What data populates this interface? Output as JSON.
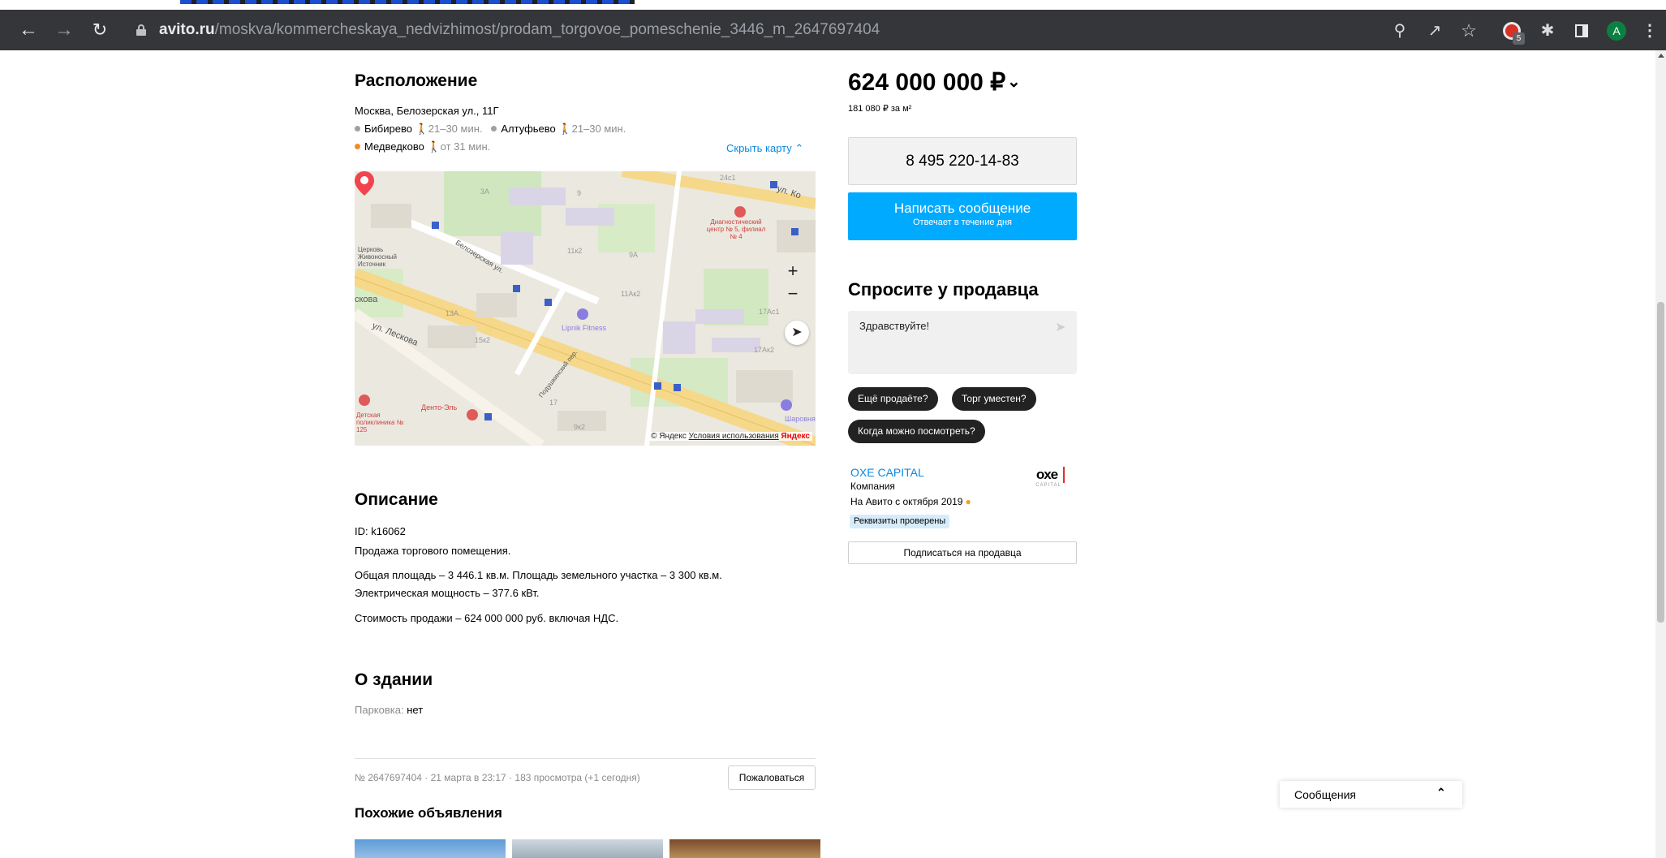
{
  "browser": {
    "url_domain": "avito.ru",
    "url_path": "/moskva/kommercheskaya_nedvizhimost/prodam_torgovoe_pomeschenie_3446_m_2647697404",
    "extension_badge": "5",
    "profile_initial": "A",
    "icons": [
      "back-arrow-icon",
      "forward-arrow-icon",
      "reload-icon",
      "lock-icon",
      "zoom-icon",
      "share-icon",
      "star-icon",
      "extension-icon",
      "puzzle-icon",
      "side-panel-icon",
      "menu-icon"
    ]
  },
  "location": {
    "title": "Расположение",
    "address": "Москва, Белозерская ул., 11Г",
    "metro": [
      {
        "name": "Бибирево",
        "time": "21–30 мин.",
        "color": "#a0a0a0"
      },
      {
        "name": "Алтуфьево",
        "time": "21–30 мин.",
        "color": "#a0a0a0"
      },
      {
        "name": "Медведково",
        "time": "от 31 мин.",
        "color": "#f28c28"
      }
    ],
    "hide_map_label": "Скрыть карту"
  },
  "map": {
    "credit": "© Яндекс",
    "terms": "Условия использования",
    "logo": "Яндекс",
    "zoom_in": "+",
    "zoom_out": "−",
    "labels": {
      "street_ul_ko": "ул. Ко",
      "diag_center": "Диагностический центр № 5, филиал № 4",
      "church": "Церковь Живоносный Источник",
      "belozerskaya": "Белозерская ул.",
      "lipnik": "Lipnik Fitness",
      "leskova": "ул. Лескова",
      "skova": "скова",
      "podushkin": "Подушкинский пер.",
      "detskaya": "Детская поликлиника № 125",
      "dento": "Денто-Эль",
      "sharovnya": "Шаровня",
      "h24c1": "24с1",
      "h11Ak2": "11Ак2",
      "h17Ac1": "17Ас1",
      "h17Ak2": "17Ак2",
      "h13A": "13А",
      "h15k2": "15к2",
      "h3A": "3А",
      "h9": "9",
      "h17": "17",
      "h11k2": "11к2",
      "h9A": "9А",
      "h9k2": "9к2"
    }
  },
  "description": {
    "title": "Описание",
    "id_line": "ID: k16062",
    "line1": "Продажа торгового помещения.",
    "line2": "Общая площадь – 3 446.1 кв.м. Площадь земельного участка – 3 300 кв.м.",
    "line3": "Электрическая мощность – 377.6 кВт.",
    "line4": "Стоимость продажи – 624 000 000 руб. включая НДС."
  },
  "building": {
    "title": "О здании",
    "parking_label": "Парковка:",
    "parking_value": "нет"
  },
  "footer": {
    "ad_meta": "№ 2647697404 · 21 марта в 23:17 · 183 просмотра (+1 сегодня)",
    "complain": "Пожаловаться",
    "similar_title": "Похожие объявления"
  },
  "sidebar": {
    "price": "624 000 000 ₽",
    "price_per_m": "181 080 ₽ за м²",
    "phone": "8 495 220-14-83",
    "message_title": "Написать сообщение",
    "message_sub": "Отвечает в течение дня",
    "ask_title": "Спросите у продавца",
    "ask_input": "Здравствуйте!",
    "chips": [
      "Ещё продаёте?",
      "Торг уместен?",
      "Когда можно посмотреть?"
    ],
    "seller_name": "OXE CAPITAL",
    "seller_type": "Компания",
    "seller_since": "На Авито с октября 2019",
    "verified": "Реквизиты проверены",
    "logo_mark": "oxe",
    "logo_sub": "CAPITAL",
    "subscribe": "Подписаться на продавца"
  },
  "messenger": {
    "label": "Сообщения"
  },
  "colors": {
    "link": "#0a89e0",
    "primary_button": "#00aaff",
    "chip": "#222222"
  }
}
